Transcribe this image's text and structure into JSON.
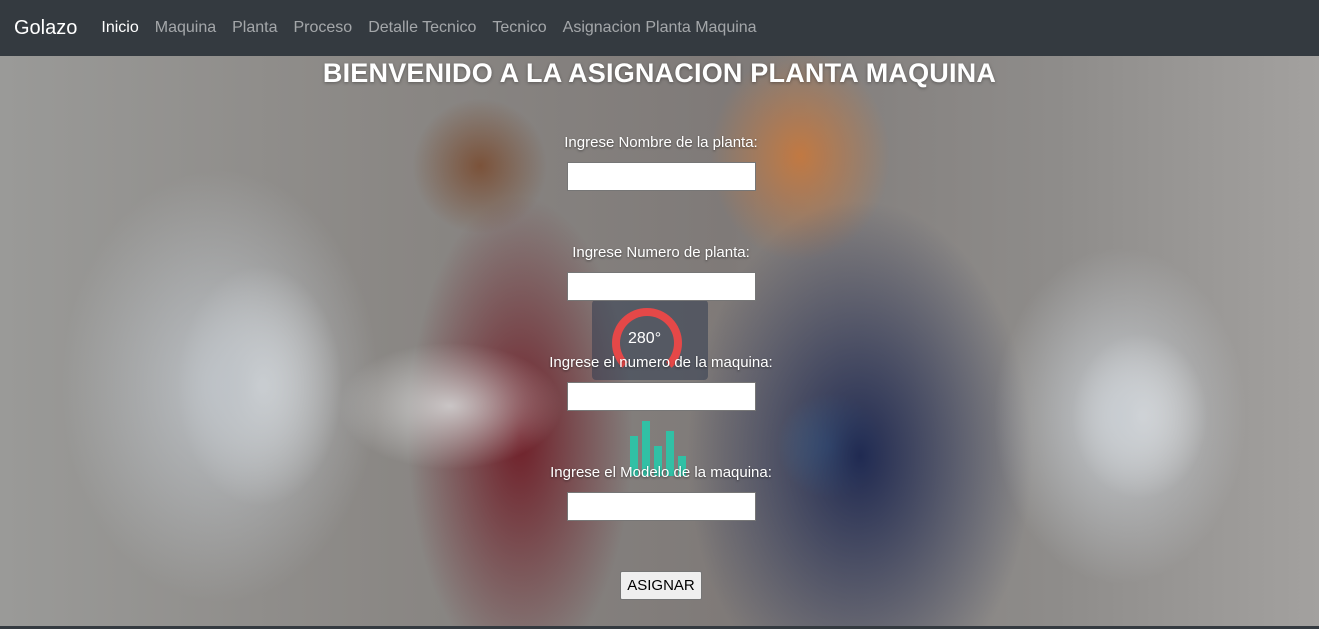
{
  "navbar": {
    "brand": "Golazo",
    "links": [
      "Inicio",
      "Maquina",
      "Planta",
      "Proceso",
      "Detalle Tecnico",
      "Tecnico",
      "Asignacion Planta Maquina"
    ],
    "active": "Inicio"
  },
  "page": {
    "title": "BIENVENIDO A LA ASIGNACION PLANTA MAQUINA"
  },
  "form": {
    "fields": [
      {
        "label": "Ingrese Nombre de la planta:",
        "value": ""
      },
      {
        "label": "Ingrese Numero de planta:",
        "value": ""
      },
      {
        "label": "Ingrese el numero de la maquina:",
        "value": ""
      },
      {
        "label": "Ingrese el Modelo de la maquina:",
        "value": ""
      }
    ],
    "submit_label": "ASIGNAR"
  },
  "background": {
    "gauge_text": "280°"
  },
  "colors": {
    "navbar_bg": "#343a40",
    "nav_active": "#ffffff",
    "nav_inactive": "rgba(255,255,255,0.55)"
  }
}
